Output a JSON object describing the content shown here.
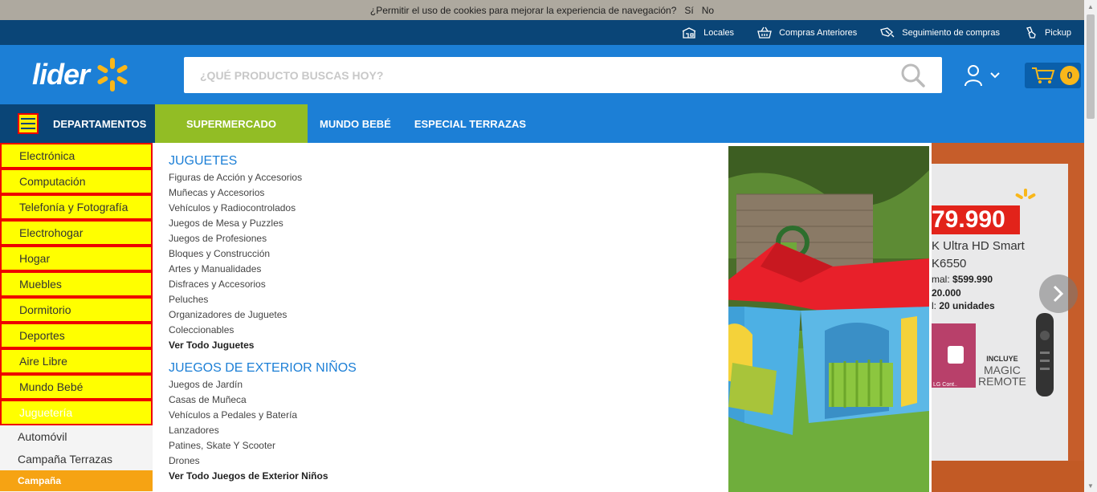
{
  "cookie_bar": {
    "text": "¿Permitir el uso de cookies para mejorar la experiencia de navegación?",
    "yes": "Sí",
    "no": "No"
  },
  "top_links": [
    {
      "label": "Locales",
      "icon": "store-icon"
    },
    {
      "label": "Compras Anteriores",
      "icon": "basket-icon"
    },
    {
      "label": "Seguimiento de compras",
      "icon": "truck-icon"
    },
    {
      "label": "Pickup",
      "icon": "hand-icon"
    }
  ],
  "header": {
    "logo_text": "lider",
    "search_placeholder": "¿QUÉ PRODUCTO BUSCAS HOY?",
    "cart_count": "0"
  },
  "nav": {
    "departments": "DEPARTAMENTOS",
    "items": [
      "SUPERMERCADO",
      "MUNDO BEBÉ",
      "ESPECIAL TERRAZAS"
    ]
  },
  "sidebar": {
    "highlighted": [
      "Electrónica",
      "Computación",
      "Telefonía y Fotografía",
      "Electrohogar",
      "Hogar",
      "Muebles",
      "Dormitorio",
      "Deportes",
      "Aire Libre",
      "Mundo Bebé",
      "Juguetería"
    ],
    "others": [
      "Automóvil",
      "Campaña Terrazas"
    ],
    "campaign": "Campaña"
  },
  "mega_menu": {
    "section1": {
      "title": "JUGUETES",
      "links": [
        "Figuras de Acción y Accesorios",
        "Muñecas y Accesorios",
        "Vehículos y Radiocontrolados",
        "Juegos de Mesa y Puzzles",
        "Juegos de Profesiones",
        "Bloques y Construcción",
        "Artes y Manualidades",
        "Disfraces y Accesorios",
        "Peluches",
        "Organizadores de Juguetes",
        "Coleccionables"
      ],
      "see_all": "Ver Todo Juguetes"
    },
    "section2": {
      "title": "JUEGOS DE EXTERIOR NIÑOS",
      "links": [
        "Juegos de Jardín",
        "Casas de Muñeca",
        "Vehículos a Pedales y Batería",
        "Lanzadores",
        "Patines, Skate Y Scooter",
        "Drones"
      ],
      "see_all": "Ver Todo Juegos de Exterior Niños"
    }
  },
  "banner": {
    "price": "79.990",
    "line1": "K Ultra HD Smart",
    "line2": "K6550",
    "line3_prefix": "mal: ",
    "line3_value": "$599.990",
    "line4": "20.000",
    "line5_prefix": "l: ",
    "line5_value": "20 unidades",
    "remote_small": "INCLUYE",
    "remote_big1": "MAGIC",
    "remote_big2": "REMOTE"
  },
  "colors": {
    "brand_blue": "#1c7fd6",
    "dark_blue": "#0a4577",
    "green": "#92bd25",
    "yellow": "#ffff00",
    "orange": "#f6a313",
    "spark": "#f9b71a"
  }
}
